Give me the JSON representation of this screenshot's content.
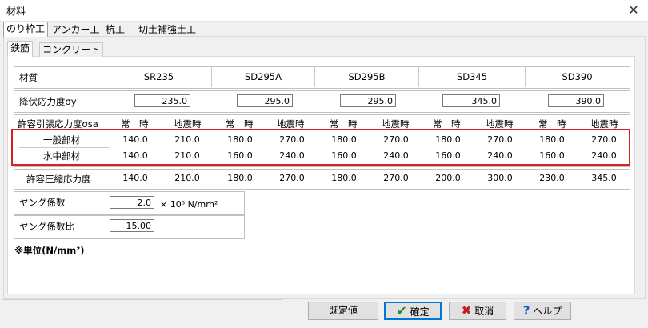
{
  "window": {
    "title": "材料",
    "close": "✕"
  },
  "tabs": [
    "のり枠工",
    "アンカー工",
    "杭工",
    "切土補強土工"
  ],
  "subtabs": [
    "鉄筋",
    "コンクリート"
  ],
  "material": {
    "label": "材質",
    "grades": [
      "SR235",
      "SD295A",
      "SD295B",
      "SD345",
      "SD390"
    ]
  },
  "yield": {
    "label": "降伏応力度σy",
    "values": [
      "235.0",
      "295.0",
      "295.0",
      "345.0",
      "390.0"
    ]
  },
  "tensile": {
    "label": "許容引張応力度σsa",
    "col_normal": "常　時",
    "col_quake": "地震時",
    "rows": [
      {
        "label": "一般部材",
        "values": [
          "140.0",
          "210.0",
          "180.0",
          "270.0",
          "180.0",
          "270.0",
          "180.0",
          "270.0",
          "180.0",
          "270.0"
        ]
      },
      {
        "label": "水中部材",
        "values": [
          "140.0",
          "210.0",
          "160.0",
          "240.0",
          "160.0",
          "240.0",
          "160.0",
          "240.0",
          "160.0",
          "240.0"
        ]
      }
    ]
  },
  "compressive": {
    "label": "許容圧縮応力度",
    "values": [
      "140.0",
      "210.0",
      "180.0",
      "270.0",
      "180.0",
      "270.0",
      "200.0",
      "300.0",
      "230.0",
      "345.0"
    ]
  },
  "young": {
    "label": "ヤング係数",
    "value": "2.0",
    "unit": "× 10⁵ N/mm²"
  },
  "young_ratio": {
    "label": "ヤング係数比",
    "value": "15.00"
  },
  "unit_note": "※単位(N/mm²)",
  "buttons": {
    "default": "既定値",
    "ok": "確定",
    "cancel": "取消",
    "help": "ヘルプ"
  },
  "colors": {
    "highlight": "#d82020",
    "focus": "#0078d7"
  }
}
